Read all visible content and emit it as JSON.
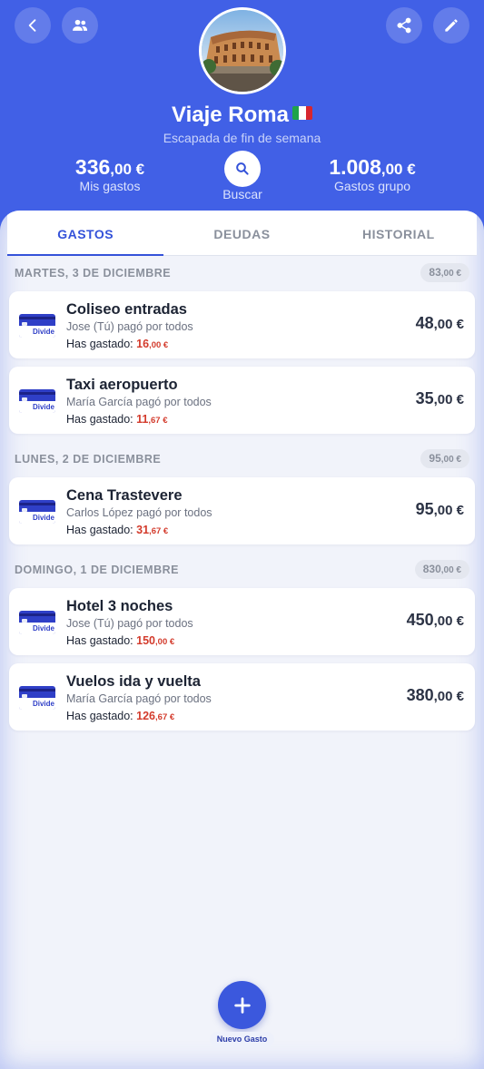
{
  "header": {
    "title": "Viaje Roma",
    "subtitle": "Escapada de fin de semana",
    "my_expenses": {
      "int": "336",
      "dec": ",00 €",
      "label": "Mis gastos"
    },
    "group_expenses": {
      "int": "1.008",
      "dec": ",00 €",
      "label": "Gastos grupo"
    },
    "search_label": "Buscar",
    "flag_colors": [
      "#1fa34a",
      "#ffffff",
      "#d7262f"
    ]
  },
  "tabs": [
    {
      "label": "GASTOS",
      "active": true
    },
    {
      "label": "DEUDAS",
      "active": false
    },
    {
      "label": "HISTORIAL",
      "active": false
    }
  ],
  "days": [
    {
      "label": "MARTES, 3 DE DICIEMBRE",
      "total_int": "83",
      "total_dec": ",00 €",
      "expenses": [
        {
          "name": "Coliseo entradas",
          "payer": "Jose (Tú) pagó por todos",
          "spent_label": "Has gastado:",
          "spent_int": "16",
          "spent_dec": ",00 €",
          "amount_int": "48",
          "amount_dec": ",00 €"
        },
        {
          "name": "Taxi aeropuerto",
          "payer": "María García pagó por todos",
          "spent_label": "Has gastado:",
          "spent_int": "11",
          "spent_dec": ",67 €",
          "amount_int": "35",
          "amount_dec": ",00 €"
        }
      ]
    },
    {
      "label": "LUNES, 2 DE DICIEMBRE",
      "total_int": "95",
      "total_dec": ",00 €",
      "expenses": [
        {
          "name": "Cena Trastevere",
          "payer": "Carlos López pagó por todos",
          "spent_label": "Has gastado:",
          "spent_int": "31",
          "spent_dec": ",67 €",
          "amount_int": "95",
          "amount_dec": ",00 €"
        }
      ]
    },
    {
      "label": "DOMINGO, 1 DE DICIEMBRE",
      "total_int": "830",
      "total_dec": ",00 €",
      "expenses": [
        {
          "name": "Hotel 3 noches",
          "payer": "Jose (Tú) pagó por todos",
          "spent_label": "Has gastado:",
          "spent_int": "150",
          "spent_dec": ",00 €",
          "amount_int": "450",
          "amount_dec": ",00 €"
        },
        {
          "name": "Vuelos ida y vuelta",
          "payer": "María García pagó por todos",
          "spent_label": "Has gastado:",
          "spent_int": "126",
          "spent_dec": ",67 €",
          "amount_int": "380",
          "amount_dec": ",00 €"
        }
      ]
    }
  ],
  "card_brand": "Divide",
  "fab_label": "Nuevo Gasto",
  "colors": {
    "primary": "#4160e6",
    "accent": "#3452d9",
    "negative": "#d33b2c"
  }
}
